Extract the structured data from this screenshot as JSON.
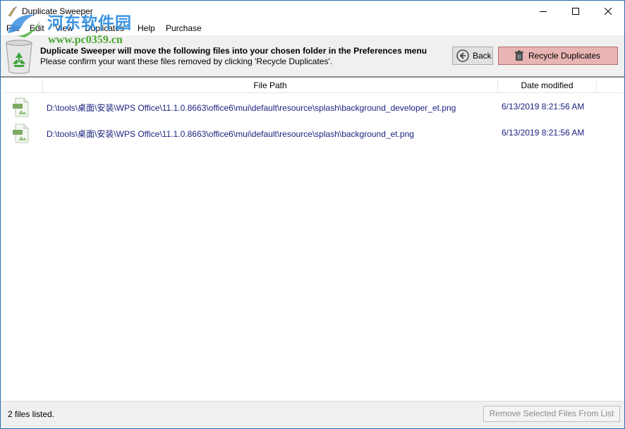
{
  "window": {
    "title": "Duplicate Sweeper"
  },
  "watermark": {
    "cn_text": "河东软件园",
    "url": "www.pc0359.cn"
  },
  "menu": {
    "items": [
      {
        "label": "File"
      },
      {
        "label": "Edit"
      },
      {
        "label": "View"
      },
      {
        "label": "Duplicates"
      },
      {
        "label": "Help"
      },
      {
        "label": "Purchase"
      }
    ]
  },
  "info": {
    "line1": "Duplicate Sweeper will move the following files into your chosen folder in the Preferences menu",
    "line2": "Please confirm your want these files removed by clicking 'Recycle Duplicates'."
  },
  "buttons": {
    "back": "Back",
    "recycle": "Recycle Duplicates",
    "remove": "Remove Selected Files From List"
  },
  "table": {
    "columns": {
      "path": "File Path",
      "date": "Date modified"
    },
    "rows": [
      {
        "icon": "png-file-icon",
        "path": "D:\\tools\\桌面\\安装\\WPS Office\\11.1.0.8663\\office6\\mui\\default\\resource\\splash\\background_developer_et.png",
        "date": "6/13/2019 8:21:56 AM"
      },
      {
        "icon": "png-file-icon",
        "path": "D:\\tools\\桌面\\安装\\WPS Office\\11.1.0.8663\\office6\\mui\\default\\resource\\splash\\background_et.png",
        "date": "6/13/2019 8:21:56 AM"
      }
    ]
  },
  "status": {
    "text": "2 files listed."
  },
  "colors": {
    "recycle_button": "#e8b4b4",
    "path_text": "#1a237e",
    "window_border": "#2b6fb6"
  }
}
